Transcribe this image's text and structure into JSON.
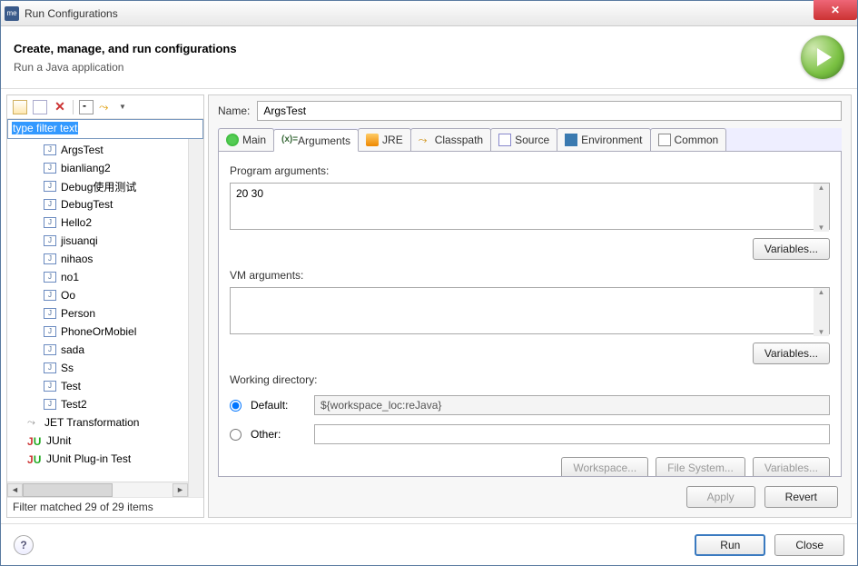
{
  "window": {
    "title": "Run Configurations"
  },
  "header": {
    "title": "Create, manage, and run configurations",
    "subtitle": "Run a Java application"
  },
  "filter": {
    "text": "type filter text"
  },
  "tree": {
    "items": [
      "ArgsTest",
      "bianliang2",
      "Debug使用测试",
      "DebugTest",
      "Hello2",
      "jisuanqi",
      "nihaos",
      "no1",
      "Oo",
      "Person",
      "PhoneOrMobiel",
      "sada",
      "Ss",
      "Test",
      "Test2"
    ],
    "jet": "JET Transformation",
    "junit": "JUnit",
    "junit_plugin": "JUnit Plug-in Test"
  },
  "status": "Filter matched 29 of 29 items",
  "name": {
    "label": "Name:",
    "value": "ArgsTest"
  },
  "tabs": {
    "main": "Main",
    "args": "Arguments",
    "jre": "JRE",
    "classpath": "Classpath",
    "source": "Source",
    "env": "Environment",
    "common": "Common"
  },
  "args": {
    "prog_label": "Program arguments:",
    "prog_value": "20 30",
    "vm_label": "VM arguments:",
    "vm_value": "",
    "variables": "Variables...",
    "wd_label": "Working directory:",
    "default_label": "Default:",
    "default_value": "${workspace_loc:reJava}",
    "other_label": "Other:",
    "workspace_btn": "Workspace...",
    "filesystem_btn": "File System...",
    "variables_btn": "Variables..."
  },
  "buttons": {
    "apply": "Apply",
    "revert": "Revert",
    "run": "Run",
    "close": "Close"
  }
}
